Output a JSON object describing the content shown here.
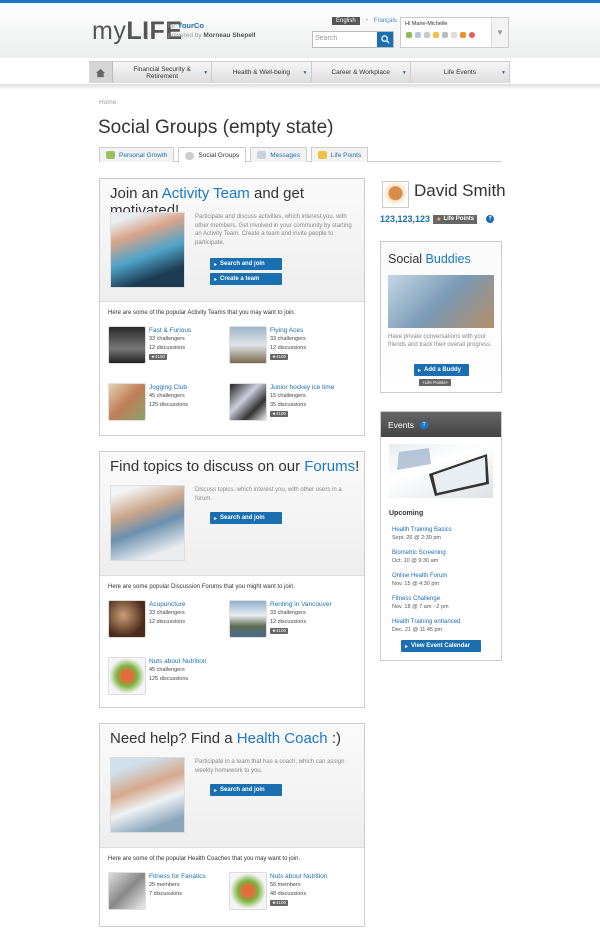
{
  "brand": {
    "logo_a": "my",
    "logo_b": "LIFE",
    "for": "for",
    "company": "YourCo",
    "powered": "powered by",
    "provider": "Morneau Shepell"
  },
  "header": {
    "lang_active": "English",
    "lang_other": "Français",
    "search_placeholder": "Search",
    "greeting": "Hi Marie-Michelle"
  },
  "nav": {
    "items": [
      {
        "label": "Financial Security & Retirement"
      },
      {
        "label": "Health & Well-being"
      },
      {
        "label": "Career & Workplace"
      },
      {
        "label": "Life Events"
      }
    ]
  },
  "breadcrumb": "Home",
  "page_title": "Social Groups (empty state)",
  "tabs": [
    {
      "label": "Personal Growth"
    },
    {
      "label": "Social Groups"
    },
    {
      "label": "Messages"
    },
    {
      "label": "Life Points"
    }
  ],
  "activity": {
    "title_a": "Join an ",
    "title_b": "Activity Team",
    "title_c": " and get motivated!",
    "desc": "Participate and discuss activities, which interest you, with other members. Get involved in your community by starting an Activity Team. Create a team and invite people to participate.",
    "btn1": "Search and join",
    "btn2": "Create a team",
    "lead": "Here are some of the popular Activity Teams that you may want to join.",
    "items": [
      {
        "name": "Fast & Furious",
        "l1": "33 challengers",
        "l2": "12 discussions",
        "badge": "★4100"
      },
      {
        "name": "Flying Aces",
        "l1": "33 challengers",
        "l2": "12 discussions",
        "badge": "★4100"
      },
      {
        "name": "Jogging Club",
        "l1": "45 challengers",
        "l2": "125 discussions",
        "badge": ""
      },
      {
        "name": "Junior hockey ice time",
        "l1": "15 challengers",
        "l2": "35 discussions",
        "badge": "★4100"
      }
    ]
  },
  "forums": {
    "title_a": "Find topics to discuss on our ",
    "title_b": "Forums",
    "title_c": "!",
    "desc": "Discuss topics, which interest you, with other users in a forum.",
    "btn1": "Search and join",
    "lead": "Here are some popular Discussion Forums that you might want to join.",
    "items": [
      {
        "name": "Acupuncture",
        "l1": "33 challengers",
        "l2": "12 discussions",
        "badge": ""
      },
      {
        "name": "Renting in Vancouver",
        "l1": "33 challengers",
        "l2": "12 discussions",
        "badge": "★4100"
      },
      {
        "name": "Nuts about Nutrition",
        "l1": "45 challengers",
        "l2": "125 discussions",
        "badge": ""
      }
    ]
  },
  "coach": {
    "title_a": "Need help? Find a ",
    "title_b": "Health Coach",
    "title_c": " :)",
    "desc": "Participate in a team that has a coach, which can assign weekly homework to you.",
    "btn1": "Search and join",
    "lead": "Here are some of the popular Health Coaches that you may want to join.",
    "items": [
      {
        "name": "Fitness for Fanatics",
        "l1": "25 members",
        "l2": "7 discussions",
        "badge": ""
      },
      {
        "name": "Nuts about Nutrition",
        "l1": "56 members",
        "l2": "48 discussions",
        "badge": "★4100"
      }
    ]
  },
  "profile": {
    "name": "David Smith",
    "points": "123,123,123",
    "points_label": "Life Points"
  },
  "buddies": {
    "title_a": "Social ",
    "title_b": "Buddies",
    "desc": "Have private conversations with your friends and track their overall progress.",
    "btn": "Add a Buddy",
    "tag": "+Life Points+"
  },
  "events": {
    "title": "Events",
    "upcoming": "Upcoming",
    "items": [
      {
        "title": "Health Training Basics",
        "date": "Sept. 26 @ 2:30 pm"
      },
      {
        "title": "Biometric Screening",
        "date": "Oct. 10 @ 9:30 am"
      },
      {
        "title": "Online Health Forum",
        "date": "Nov. 15 @ 4:30 pm"
      },
      {
        "title": "Fitness Challenge",
        "date": "Nov. 18 @ 7 am - 2 pm"
      },
      {
        "title": "Health Training enhanced",
        "date": "Dec. 21 @ 11:45 pm"
      }
    ],
    "btn": "View Event Calendar"
  }
}
